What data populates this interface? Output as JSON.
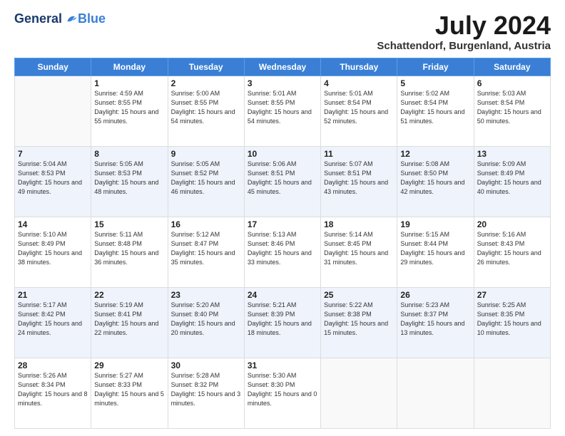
{
  "logo": {
    "general": "General",
    "blue": "Blue"
  },
  "header": {
    "title": "July 2024",
    "subtitle": "Schattendorf, Burgenland, Austria"
  },
  "days_of_week": [
    "Sunday",
    "Monday",
    "Tuesday",
    "Wednesday",
    "Thursday",
    "Friday",
    "Saturday"
  ],
  "weeks": [
    [
      {
        "day": "",
        "info": ""
      },
      {
        "day": "1",
        "info": "Sunrise: 4:59 AM\nSunset: 8:55 PM\nDaylight: 15 hours\nand 55 minutes."
      },
      {
        "day": "2",
        "info": "Sunrise: 5:00 AM\nSunset: 8:55 PM\nDaylight: 15 hours\nand 54 minutes."
      },
      {
        "day": "3",
        "info": "Sunrise: 5:01 AM\nSunset: 8:55 PM\nDaylight: 15 hours\nand 54 minutes."
      },
      {
        "day": "4",
        "info": "Sunrise: 5:01 AM\nSunset: 8:54 PM\nDaylight: 15 hours\nand 52 minutes."
      },
      {
        "day": "5",
        "info": "Sunrise: 5:02 AM\nSunset: 8:54 PM\nDaylight: 15 hours\nand 51 minutes."
      },
      {
        "day": "6",
        "info": "Sunrise: 5:03 AM\nSunset: 8:54 PM\nDaylight: 15 hours\nand 50 minutes."
      }
    ],
    [
      {
        "day": "7",
        "info": "Sunrise: 5:04 AM\nSunset: 8:53 PM\nDaylight: 15 hours\nand 49 minutes."
      },
      {
        "day": "8",
        "info": "Sunrise: 5:05 AM\nSunset: 8:53 PM\nDaylight: 15 hours\nand 48 minutes."
      },
      {
        "day": "9",
        "info": "Sunrise: 5:05 AM\nSunset: 8:52 PM\nDaylight: 15 hours\nand 46 minutes."
      },
      {
        "day": "10",
        "info": "Sunrise: 5:06 AM\nSunset: 8:51 PM\nDaylight: 15 hours\nand 45 minutes."
      },
      {
        "day": "11",
        "info": "Sunrise: 5:07 AM\nSunset: 8:51 PM\nDaylight: 15 hours\nand 43 minutes."
      },
      {
        "day": "12",
        "info": "Sunrise: 5:08 AM\nSunset: 8:50 PM\nDaylight: 15 hours\nand 42 minutes."
      },
      {
        "day": "13",
        "info": "Sunrise: 5:09 AM\nSunset: 8:49 PM\nDaylight: 15 hours\nand 40 minutes."
      }
    ],
    [
      {
        "day": "14",
        "info": "Sunrise: 5:10 AM\nSunset: 8:49 PM\nDaylight: 15 hours\nand 38 minutes."
      },
      {
        "day": "15",
        "info": "Sunrise: 5:11 AM\nSunset: 8:48 PM\nDaylight: 15 hours\nand 36 minutes."
      },
      {
        "day": "16",
        "info": "Sunrise: 5:12 AM\nSunset: 8:47 PM\nDaylight: 15 hours\nand 35 minutes."
      },
      {
        "day": "17",
        "info": "Sunrise: 5:13 AM\nSunset: 8:46 PM\nDaylight: 15 hours\nand 33 minutes."
      },
      {
        "day": "18",
        "info": "Sunrise: 5:14 AM\nSunset: 8:45 PM\nDaylight: 15 hours\nand 31 minutes."
      },
      {
        "day": "19",
        "info": "Sunrise: 5:15 AM\nSunset: 8:44 PM\nDaylight: 15 hours\nand 29 minutes."
      },
      {
        "day": "20",
        "info": "Sunrise: 5:16 AM\nSunset: 8:43 PM\nDaylight: 15 hours\nand 26 minutes."
      }
    ],
    [
      {
        "day": "21",
        "info": "Sunrise: 5:17 AM\nSunset: 8:42 PM\nDaylight: 15 hours\nand 24 minutes."
      },
      {
        "day": "22",
        "info": "Sunrise: 5:19 AM\nSunset: 8:41 PM\nDaylight: 15 hours\nand 22 minutes."
      },
      {
        "day": "23",
        "info": "Sunrise: 5:20 AM\nSunset: 8:40 PM\nDaylight: 15 hours\nand 20 minutes."
      },
      {
        "day": "24",
        "info": "Sunrise: 5:21 AM\nSunset: 8:39 PM\nDaylight: 15 hours\nand 18 minutes."
      },
      {
        "day": "25",
        "info": "Sunrise: 5:22 AM\nSunset: 8:38 PM\nDaylight: 15 hours\nand 15 minutes."
      },
      {
        "day": "26",
        "info": "Sunrise: 5:23 AM\nSunset: 8:37 PM\nDaylight: 15 hours\nand 13 minutes."
      },
      {
        "day": "27",
        "info": "Sunrise: 5:25 AM\nSunset: 8:35 PM\nDaylight: 15 hours\nand 10 minutes."
      }
    ],
    [
      {
        "day": "28",
        "info": "Sunrise: 5:26 AM\nSunset: 8:34 PM\nDaylight: 15 hours\nand 8 minutes."
      },
      {
        "day": "29",
        "info": "Sunrise: 5:27 AM\nSunset: 8:33 PM\nDaylight: 15 hours\nand 5 minutes."
      },
      {
        "day": "30",
        "info": "Sunrise: 5:28 AM\nSunset: 8:32 PM\nDaylight: 15 hours\nand 3 minutes."
      },
      {
        "day": "31",
        "info": "Sunrise: 5:30 AM\nSunset: 8:30 PM\nDaylight: 15 hours\nand 0 minutes."
      },
      {
        "day": "",
        "info": ""
      },
      {
        "day": "",
        "info": ""
      },
      {
        "day": "",
        "info": ""
      }
    ]
  ]
}
